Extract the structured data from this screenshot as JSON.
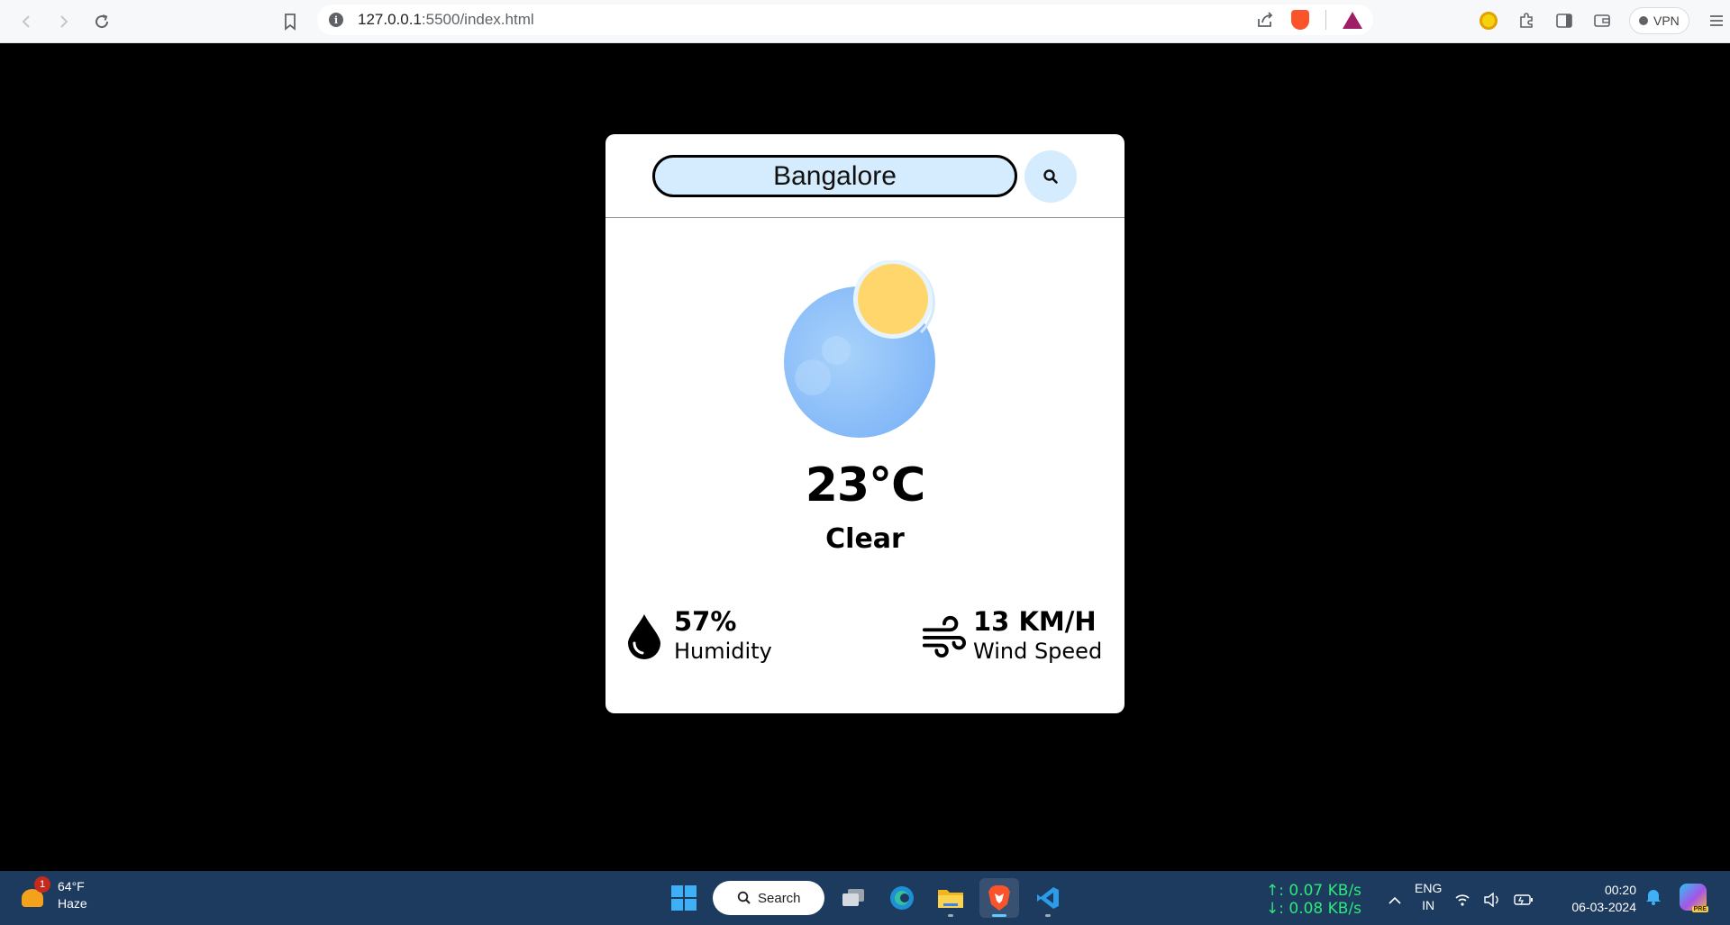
{
  "browser": {
    "url_host": "127.0.0.1",
    "url_path": ":5500/index.html",
    "vpn_label": "VPN"
  },
  "weather_app": {
    "search_value": "Bangalore",
    "temperature": "23°C",
    "condition": "Clear",
    "humidity_value": "57%",
    "humidity_label": "Humidity",
    "wind_value": "13 KM/H",
    "wind_label": "Wind Speed"
  },
  "taskbar": {
    "weather_temp": "64°F",
    "weather_desc": "Haze",
    "weather_badge": "1",
    "search_label": "Search",
    "net_up": "↑: 0.07 KB/s",
    "net_down": "↓: 0.08 KB/s",
    "lang_line1": "ENG",
    "lang_line2": "IN",
    "time": "00:20",
    "date": "06-03-2024",
    "copilot_badge": "PRE"
  },
  "colors": {
    "page_bg": "#000000",
    "card_bg": "#ffffff",
    "input_bg": "#d4ecfd",
    "taskbar_bg": "#1d3a5f",
    "net_speed": "#2ee87a"
  }
}
